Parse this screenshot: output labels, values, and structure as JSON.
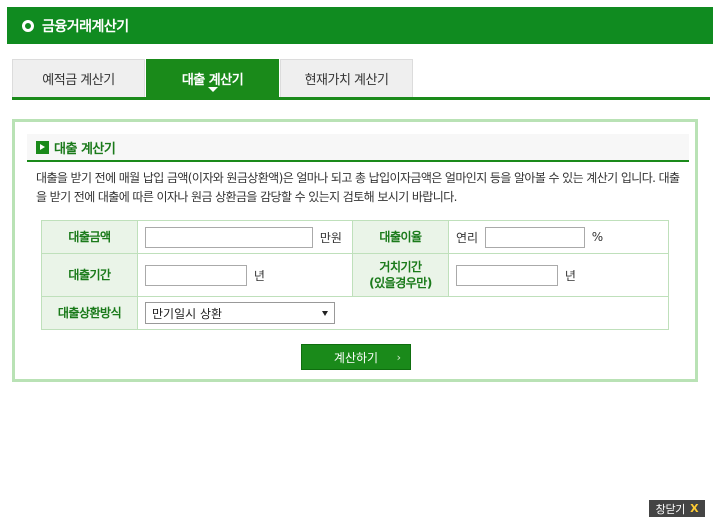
{
  "window": {
    "title": "금융거래계산기"
  },
  "tabs": [
    {
      "label": "예적금 계산기",
      "active": false
    },
    {
      "label": "대출 계산기",
      "active": true
    },
    {
      "label": "현재가치 계산기",
      "active": false
    }
  ],
  "section": {
    "title": "대출 계산기",
    "description": "대출을 받기 전에 매월 납입 금액(이자와 원금상환액)은 얼마나 되고 총 납입이자금액은 얼마인지 등을 알아볼 수 있는 계산기 입니다. 대출을 받기 전에 대출에 따른 이자나 원금 상환금을 감당할 수 있는지 검토해 보시기 바랍니다."
  },
  "form": {
    "loan_amount": {
      "label": "대출금액",
      "value": "",
      "unit": "만원"
    },
    "interest_rate": {
      "label": "대출이율",
      "prefix": "연리",
      "value": "",
      "unit": "%"
    },
    "loan_period": {
      "label": "대출기간",
      "value": "",
      "unit": "년"
    },
    "grace_period": {
      "label_line1": "거치기간",
      "label_line2": "(있을경우만)",
      "value": "",
      "unit": "년"
    },
    "repayment_method": {
      "label": "대출상환방식",
      "selected": "만기일시 상환"
    }
  },
  "buttons": {
    "calculate": "계산하기",
    "calculate_chevron": "›",
    "close": "창닫기",
    "close_x": "X"
  },
  "colors": {
    "primary_green": "#108b20",
    "label_bg": "#eaf4e8",
    "border_green": "#b9e2b5"
  }
}
